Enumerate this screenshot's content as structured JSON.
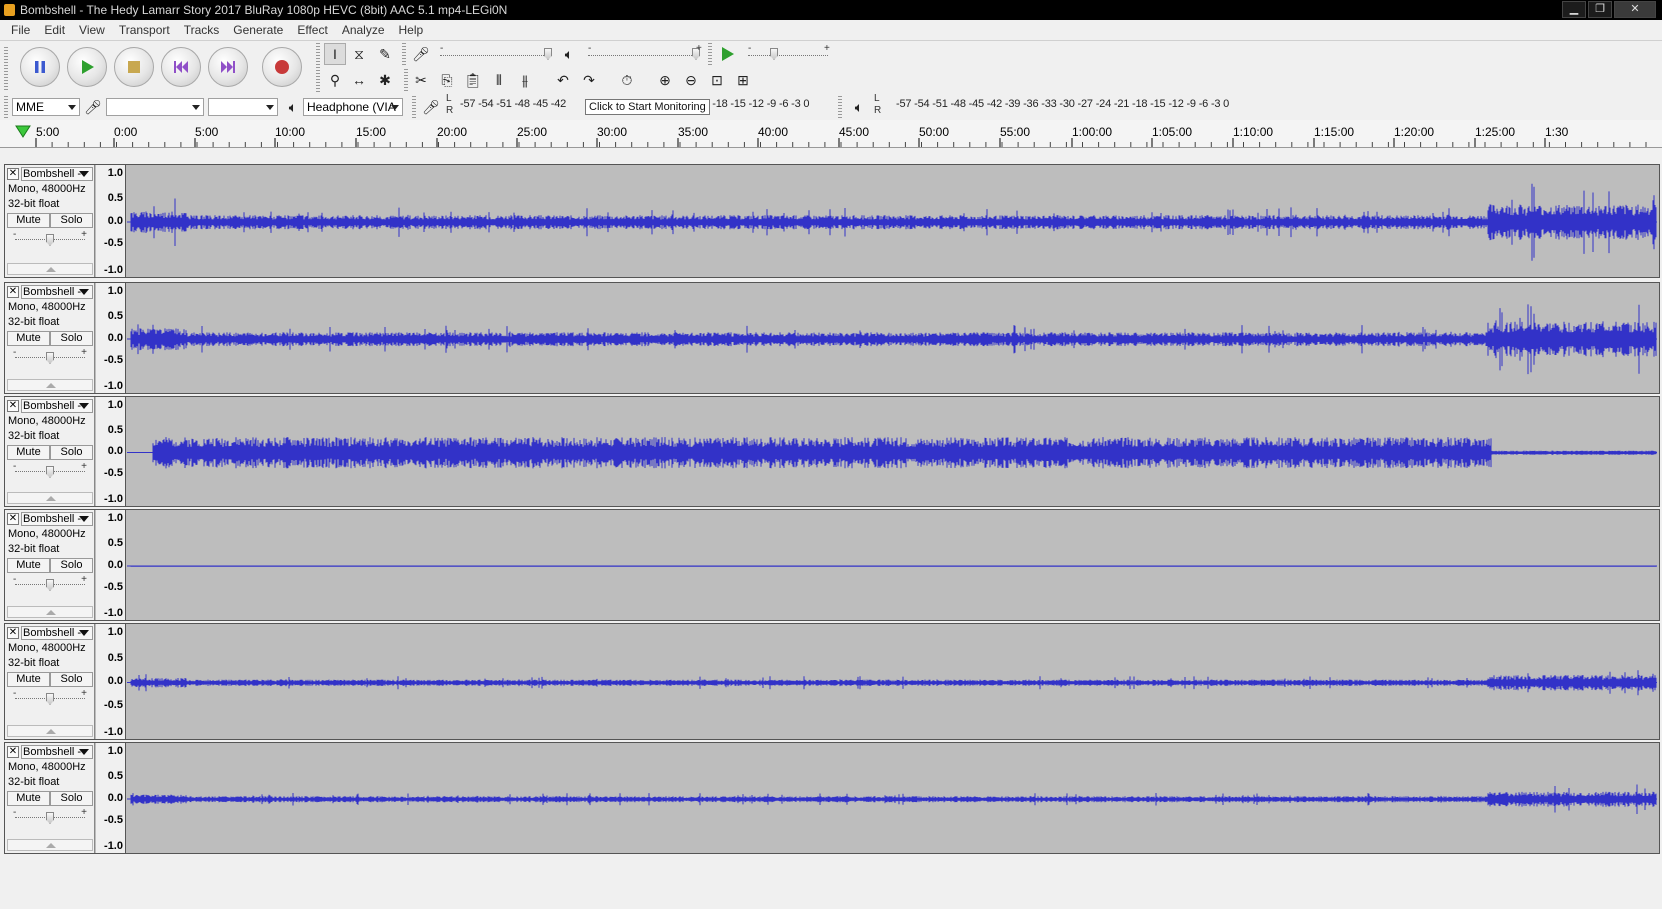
{
  "window": {
    "title": "Bombshell - The Hedy Lamarr Story 2017 BluRay 1080p HEVC (8bit) AAC 5.1 mp4-LEGi0N"
  },
  "menu": [
    "File",
    "Edit",
    "View",
    "Transport",
    "Tracks",
    "Generate",
    "Effect",
    "Analyze",
    "Help"
  ],
  "transport": {
    "buttons": [
      "pause-icon",
      "play-icon",
      "stop-icon",
      "skip-start-icon",
      "skip-end-icon",
      "record-icon"
    ]
  },
  "tools": {
    "row1": [
      "selection-tool-icon",
      "envelope-tool-icon",
      "draw-tool-icon"
    ],
    "row2": [
      "zoom-tool-icon",
      "timeshift-tool-icon",
      "multi-tool-icon"
    ]
  },
  "mixer": {
    "mic_minus": "-",
    "mic_plus": "+",
    "play_minus": "-",
    "play_plus": "+"
  },
  "device": {
    "host": "MME",
    "input_device": "",
    "channels": "",
    "output_device": "Headphone (VIA"
  },
  "meters": {
    "record_scale": "-57 -54 -51 -48 -45 -42",
    "record_scale_tail": "-1 -18 -15 -12 -9 -6 -3 0",
    "tooltip": "Click to Start Monitoring",
    "play_scale": "-57 -54 -51 -48 -45 -42 -39 -36 -33 -30 -27 -24 -21 -18 -15 -12 -9 -6 -3 0",
    "left_label": "L",
    "right_label": "R"
  },
  "ruler": {
    "labels": [
      "5:00",
      "0:00",
      "5:00",
      "10:00",
      "15:00",
      "20:00",
      "25:00",
      "30:00",
      "35:00",
      "40:00",
      "45:00",
      "50:00",
      "55:00",
      "1:00:00",
      "1:05:00",
      "1:10:00",
      "1:15:00",
      "1:20:00",
      "1:25:00",
      "1:30"
    ]
  },
  "tracks": [
    {
      "name": "Bombshell - ",
      "format": "Mono, 48000Hz",
      "bits": "32-bit float",
      "mute": "Mute",
      "solo": "Solo",
      "scale": [
        "1.0",
        "0.5",
        "0.0",
        "-0.5",
        "-1.0"
      ],
      "level": 0.12
    },
    {
      "name": "Bombshell - ",
      "format": "Mono, 48000Hz",
      "bits": "32-bit float",
      "mute": "Mute",
      "solo": "Solo",
      "scale": [
        "1.0",
        "0.5",
        "0.0",
        "-0.5",
        "-1.0"
      ],
      "level": 0.12
    },
    {
      "name": "Bombshell - ",
      "format": "Mono, 48000Hz",
      "bits": "32-bit float",
      "mute": "Mute",
      "solo": "Solo",
      "scale": [
        "1.0",
        "0.5",
        "0.0",
        "-0.5",
        "-1.0"
      ],
      "level": 0.28
    },
    {
      "name": "Bombshell - ",
      "format": "Mono, 48000Hz",
      "bits": "32-bit float",
      "mute": "Mute",
      "solo": "Solo",
      "scale": [
        "1.0",
        "0.5",
        "0.0",
        "-0.5",
        "-1.0"
      ],
      "level": 0.005
    },
    {
      "name": "Bombshell - ",
      "format": "Mono, 48000Hz",
      "bits": "32-bit float",
      "mute": "Mute",
      "solo": "Solo",
      "scale": [
        "1.0",
        "0.5",
        "0.0",
        "-0.5",
        "-1.0"
      ],
      "level": 0.05
    },
    {
      "name": "Bombshell - ",
      "format": "Mono, 48000Hz",
      "bits": "32-bit float",
      "mute": "Mute",
      "solo": "Solo",
      "scale": [
        "1.0",
        "0.5",
        "0.0",
        "-0.5",
        "-1.0"
      ],
      "level": 0.05
    }
  ],
  "colors": {
    "waveform": "#3232c8",
    "track_bg": "#bdbdbd",
    "record": "#c03030",
    "play": "#28a028"
  }
}
